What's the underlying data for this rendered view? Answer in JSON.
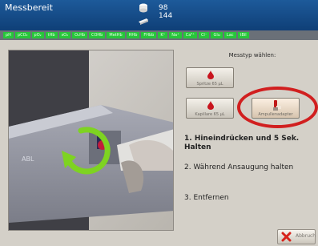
{
  "header": {
    "title": "Messbereit",
    "counter1": "98",
    "counter2": "144"
  },
  "params": [
    "pH",
    "pCO₂",
    "pO₂",
    "tHb",
    "sO₂",
    "O₂Hb",
    "COHb",
    "MetHb",
    "HHb",
    "FHbb",
    "K⁺",
    "Na⁺",
    "Ca²⁺",
    "Cl⁻",
    "Glu",
    "Lac",
    "tBil"
  ],
  "panel": {
    "measure_type_label": "Messtyp wählen:",
    "options": [
      {
        "label": "Spritze 65 µL"
      },
      {
        "label": "Kapillare 65 µL"
      },
      {
        "label": "Ampullenadapter"
      }
    ],
    "highlight_color": "#d11f1f"
  },
  "steps": [
    "1. Hineindrücken und 5 Sek. Halten",
    "2. Während Ansaugung halten",
    "3. Entfernen"
  ],
  "footer": {
    "cancel_label": "Abbruch"
  },
  "icons": {
    "counter1": "solution-pack-icon",
    "counter2": "sensor-cassette-icon",
    "option1": "blood-drop-icon",
    "option2": "blood-drop-icon",
    "option3": "ampoule-adapter-icon",
    "photo_overlay": "rotate-arrow-icon",
    "cancel": "red-x-icon"
  }
}
